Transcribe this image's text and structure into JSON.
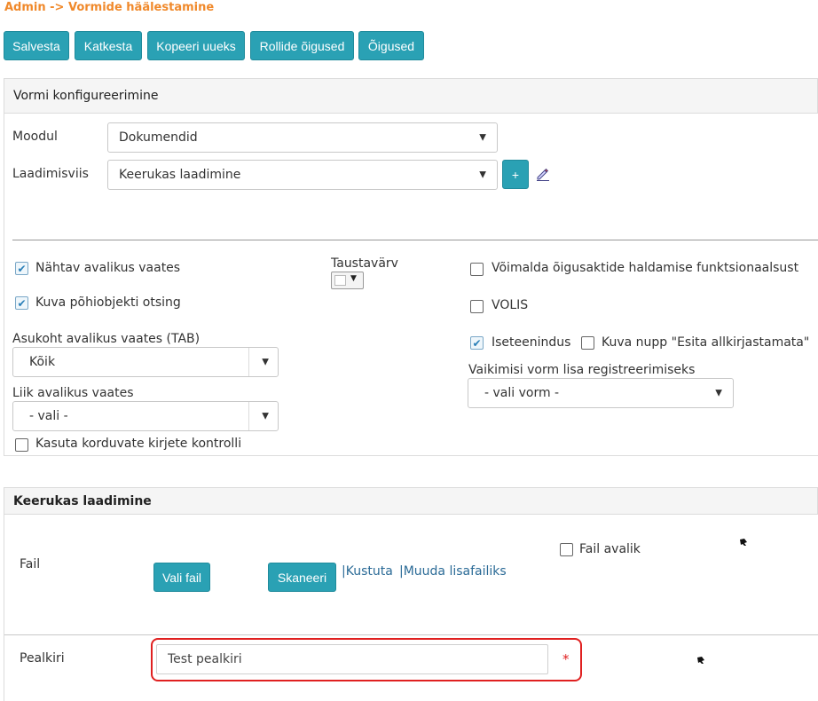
{
  "breadcrumb": "Admin -> Vormide häälestamine",
  "toolbar": {
    "save": "Salvesta",
    "cancel": "Katkesta",
    "copy_new": "Kopeeri uueks",
    "role_rights": "Rollide õigused",
    "rights": "Õigused"
  },
  "config_section": {
    "title": "Vormi konfigureerimine",
    "module_label": "Moodul",
    "module_value": "Dokumendid",
    "upload_mode_label": "Laadimisviis",
    "upload_mode_value": "Keerukas laadimine",
    "add_label": "+",
    "visible_public_label": "Nähtav avalikus vaates",
    "visible_public_checked": true,
    "show_main_search_label": "Kuva põhiobjekti otsing",
    "show_main_search_checked": true,
    "background_color_label": "Taustavärv",
    "legal_acts_label": "Võimalda õigusaktide haldamise funktsionaalsust",
    "legal_acts_checked": false,
    "volis_label": "VOLIS",
    "volis_checked": false,
    "self_service_label": "Iseteenindus",
    "self_service_checked": true,
    "show_unsigned_label": "Kuva nupp \"Esita allkirjastamata\"",
    "show_unsigned_checked": false,
    "public_tab_label": "Asukoht avalikus vaates (TAB)",
    "public_tab_value": "Kõik",
    "public_type_label": "Liik avalikus vaates",
    "public_type_value": "- vali -",
    "default_form_label": "Vaikimisi vorm lisa registreerimiseks",
    "default_form_value": "- vali vorm -",
    "duplicate_check_label": "Kasuta korduvate kirjete kontrolli",
    "duplicate_check_checked": false
  },
  "complex_section": {
    "title": "Keerukas laadimine",
    "file_label": "Fail",
    "choose_file": "Vali fail",
    "scan": "Skaneeri",
    "delete_link": "|Kustuta",
    "change_attachment_link": "|Muuda lisafailiks",
    "file_public_label": "Fail avalik",
    "file_public_checked": false,
    "title_label": "Pealkiri",
    "title_value": "Test pealkiri",
    "required_mark": "*"
  },
  "colors": {
    "accent": "#2aa1b4",
    "breadcrumb": "#f0892b",
    "highlight": "#e02020",
    "required": "#e02020"
  }
}
